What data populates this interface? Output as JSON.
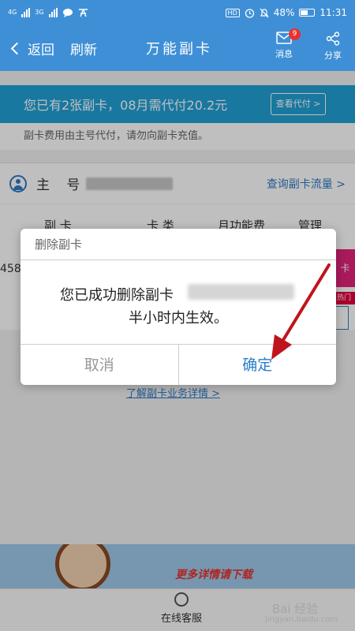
{
  "statusbar": {
    "net1": "4G",
    "net2": "3G",
    "battery": "48%",
    "time": "11:31"
  },
  "nav": {
    "back": "返回",
    "refresh": "刷新",
    "title": "万能副卡",
    "message": "消息",
    "message_badge": "9",
    "share": "分享"
  },
  "banner": {
    "text": "您已有2张副卡，08月需代付20.2元",
    "button": "查看代付 >"
  },
  "notice": "副卡费用由主号代付，请勿向副卡充值。",
  "main_number": {
    "label": "主 号",
    "query_link": "查询副卡流量 >"
  },
  "table": {
    "headers": [
      "副 卡",
      "卡 类",
      "月功能费",
      "管理"
    ],
    "partial_number": "458",
    "hot_tag": "热门"
  },
  "more_link": "了解副卡业务详情 >",
  "ad": {
    "text": "更多详情请下载"
  },
  "bottom": {
    "service": "在线客服",
    "watermark": "Bai 经验",
    "watermark_sub": "jingyan.baidu.com"
  },
  "dialog": {
    "title": "删除副卡",
    "message_line1": "您已成功删除副卡",
    "message_line2": "半小时内生效。",
    "cancel": "取消",
    "confirm": "确定"
  },
  "colors": {
    "nav": "#3f8fd6",
    "banner": "#22a0d6",
    "link": "#2f7ac4",
    "confirm": "#2a7ecb",
    "arrow": "#c0141c"
  }
}
